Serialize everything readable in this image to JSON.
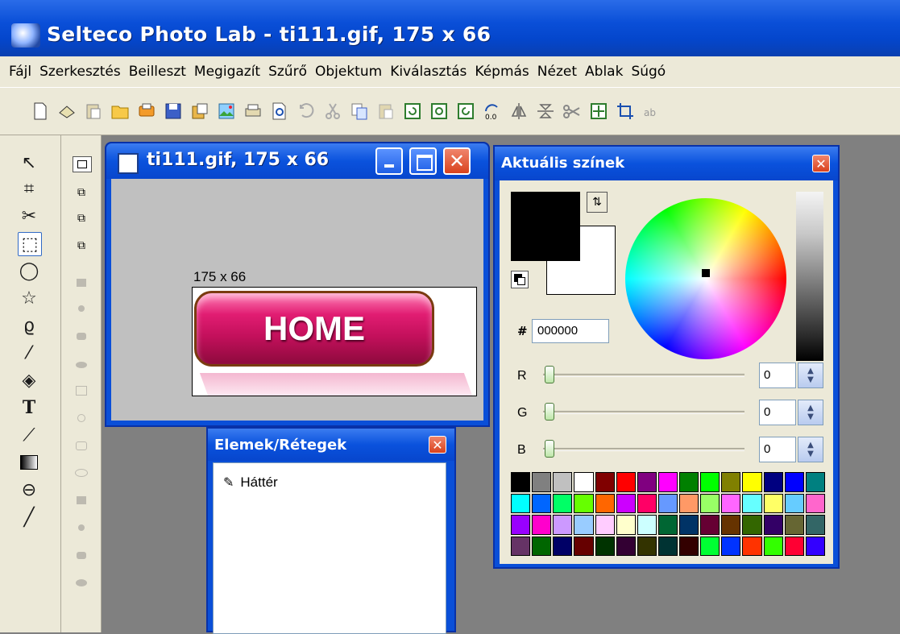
{
  "app": {
    "title": "Selteco Photo Lab - ti111.gif, 175 x 66"
  },
  "menu": [
    "Fájl",
    "Szerkesztés",
    "Beilleszt",
    "Megigazít",
    "Szűrő",
    "Objektum",
    "Kiválasztás",
    "Képmás",
    "Nézet",
    "Ablak",
    "Súgó"
  ],
  "toolbar": {
    "icons": [
      "new-icon",
      "open-scan-icon",
      "paste-new-icon",
      "open-folder-icon",
      "print-preview-icon",
      "save-icon",
      "export-icon",
      "image-icon",
      "printer-icon",
      "preview-icon",
      "undo-icon",
      "cut-icon",
      "copy-icon",
      "paste-icon",
      "rotate-icon",
      "rotate-cw-icon",
      "rotate-ccw-icon",
      "resize-icon",
      "flip-horizontal-icon",
      "flip-vertical-icon",
      "scissors-icon",
      "fit-icon",
      "crop-icon",
      "text-icon"
    ]
  },
  "tools": [
    "arrow-tool-icon",
    "crop-tool-icon",
    "cut-tool-icon",
    "rect-select-tool-icon",
    "ellipse-select-tool-icon",
    "polygon-select-tool-icon",
    "lasso-tool-icon",
    "magic-wand-tool-icon",
    "fill-tool-icon",
    "text-tool-icon",
    "eyedropper-tool-icon",
    "gradient-tool-icon",
    "paint-bucket-tool-icon",
    "line-tool-icon"
  ],
  "image_window": {
    "title": "ti111.gif, 175 x 66",
    "size_label": "175 x 66",
    "button_text": "HOME"
  },
  "layers_window": {
    "title": "Elemek/Rétegek",
    "layers": [
      "Háttér"
    ]
  },
  "color_window": {
    "title": "Aktuális színek",
    "hash": "#",
    "hex": "000000",
    "foreground": "#000000",
    "background": "#ffffff",
    "r_label": "R",
    "r_value": "0",
    "g_label": "G",
    "g_value": "0",
    "b_label": "B",
    "b_value": "0",
    "palette": [
      "#000000",
      "#808080",
      "#c0c0c0",
      "#ffffff",
      "#800000",
      "#ff0000",
      "#800080",
      "#ff00ff",
      "#008000",
      "#00ff00",
      "#808000",
      "#ffff00",
      "#000080",
      "#0000ff",
      "#008080",
      "#00ffff",
      "#0066ff",
      "#00ff66",
      "#66ff00",
      "#ff6600",
      "#cc00ff",
      "#ff0066",
      "#6699ff",
      "#ff9966",
      "#99ff66",
      "#ff66ff",
      "#66ffff",
      "#ffff66",
      "#66ccff",
      "#ff66cc",
      "#9900ff",
      "#ff00cc",
      "#cc99ff",
      "#99ccff",
      "#ffccff",
      "#ffffcc",
      "#ccffff",
      "#006633",
      "#003366",
      "#660033",
      "#663300",
      "#336600",
      "#330066",
      "#666633",
      "#336666",
      "#663366",
      "#006600",
      "#000066",
      "#660000",
      "#003300",
      "#330033",
      "#333300",
      "#003333",
      "#330000",
      "#00ff33",
      "#0033ff",
      "#ff3300",
      "#33ff00",
      "#ff0033",
      "#3300ff"
    ]
  }
}
